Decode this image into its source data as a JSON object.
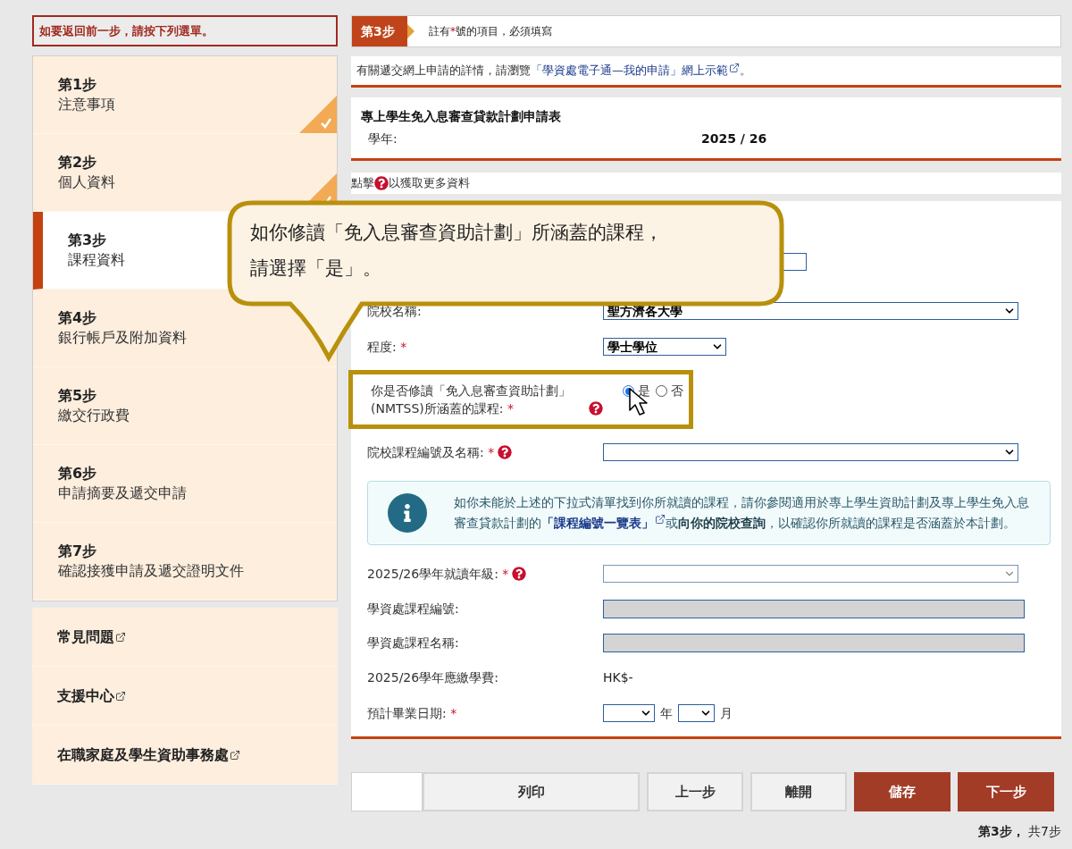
{
  "sidebar": {
    "notice": "如要返回前一步，請按下列選單。",
    "steps": [
      {
        "step": "第1步",
        "title": "注意事項",
        "completed": true,
        "selected": false
      },
      {
        "step": "第2步",
        "title": "個人資料",
        "completed": true,
        "selected": false
      },
      {
        "step": "第3步",
        "title": "課程資料",
        "completed": false,
        "selected": true
      },
      {
        "step": "第4步",
        "title": "銀行帳戶及附加資料",
        "completed": false,
        "selected": false
      },
      {
        "step": "第5步",
        "title": "繳交行政費",
        "completed": false,
        "selected": false
      },
      {
        "step": "第6步",
        "title": "申請摘要及遞交申請",
        "completed": false,
        "selected": false
      },
      {
        "step": "第7步",
        "title": "確認接獲申請及遞交證明文件",
        "completed": false,
        "selected": false
      }
    ],
    "links": [
      {
        "label": "常見問題"
      },
      {
        "label": "支援中心"
      },
      {
        "label": "在職家庭及學生資助事務處"
      }
    ]
  },
  "header": {
    "step_badge": "第3步",
    "note_before": "註有",
    "asterisk": "*",
    "note_after": "號的項目，必須填寫"
  },
  "info": {
    "text_before": "有關遞交網上申請的詳情，請瀏覽",
    "link": "「學資處電子通—我的申請」網上示範",
    "text_after": "。"
  },
  "form_title": "專上學生免入息審查貸款計劃申請表",
  "year_label": "學年:",
  "year_value": "2025 / 26",
  "help_hint": {
    "before": "點擊",
    "after": "以獲取更多資料"
  },
  "callout": {
    "lines": [
      "如你修讀「免入息審查資助計劃」所涵蓋的課程，",
      "請選擇「是」。"
    ]
  },
  "fields": [
    {
      "kind": "input"
    },
    {
      "kind": "select",
      "label": "院校名稱:",
      "value": "聖方濟各大學",
      "wide": true
    },
    {
      "kind": "select",
      "label": "程度:",
      "required": true,
      "value": "學士學位",
      "wide": false
    },
    {
      "kind": "radio",
      "label": "你是否修讀「免入息審查資助計劃」(NMTSS)所涵蓋的課程:",
      "required": true,
      "help": true,
      "highlighted": true,
      "options": [
        {
          "label": "是",
          "selected": true
        },
        {
          "label": "否",
          "selected": false
        }
      ]
    },
    {
      "kind": "select",
      "label": "院校課程編號及名稱:",
      "required": true,
      "help": true,
      "wide": true
    },
    {
      "kind": "note",
      "text_before": "如你未能於上述的下拉式清單找到你所就讀的課程，請你參閱適用於專上學生資助計劃及專上學生免入息審查貸款計劃的",
      "link": "「課程編號一覽表」",
      "text_after": "或**向你的院校查詢**，以確認你所就讀的課程是否涵蓋於本計劃。"
    },
    {
      "kind": "select",
      "label": "2025/26學年就讀年級:",
      "required": true,
      "help": true,
      "wide": true,
      "disabled": true
    },
    {
      "kind": "readonly",
      "label": "學資處課程編號:"
    },
    {
      "kind": "readonly",
      "label": "學資處課程名稱:"
    },
    {
      "kind": "static",
      "label": "2025/26學年應繳學費:",
      "value": "HK$-"
    },
    {
      "kind": "date",
      "label": "預計畢業日期:",
      "required": true,
      "units": [
        "年",
        "月"
      ]
    }
  ],
  "buttons": [
    {
      "label": "列印",
      "kind": "secondary"
    },
    {
      "label": "上一步",
      "kind": "secondary"
    },
    {
      "label": "離開",
      "kind": "secondary"
    },
    {
      "label": "儲存",
      "kind": "primary"
    },
    {
      "label": "下一步",
      "kind": "primary"
    }
  ],
  "footer": {
    "current": "第3步，",
    "total": "共7步"
  }
}
